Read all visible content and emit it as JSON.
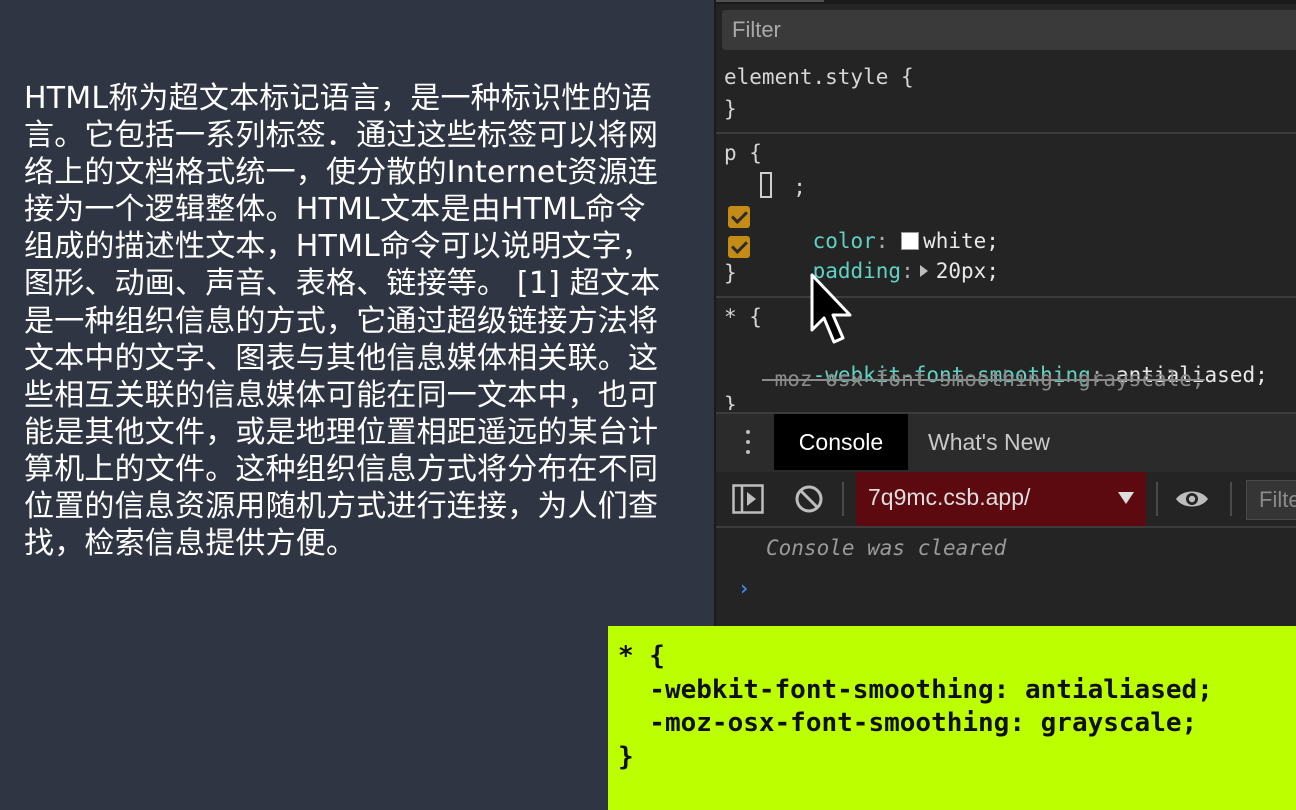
{
  "article": {
    "text": "HTML称为超文本标记语言，是一种标识性的语言。它包括一系列标签．通过这些标签可以将网络上的文档格式统一，使分散的Internet资源连接为一个逻辑整体。HTML文本是由HTML命令组成的描述性文本，HTML命令可以说明文字，图形、动画、声音、表格、链接等。 [1] 超文本是一种组织信息的方式，它通过超级链接方法将文本中的文字、图表与其他信息媒体相关联。这些相互关联的信息媒体可能在同一文本中，也可能是其他文件，或是地理位置相距遥远的某台计算机上的文件。这种组织信息方式将分布在不同位置的信息资源用随机方式进行连接，为人们查找，检索信息提供方便。"
  },
  "styles": {
    "filter_placeholder": "Filter",
    "element_style": {
      "selector": "element.style {",
      "close": "}"
    },
    "p_rule": {
      "selector": "p {",
      "empty_decl": "  ;",
      "color_prop": "color",
      "color_value": "white;",
      "padding_prop": "padding",
      "padding_value": "20px;",
      "close": "}"
    },
    "star_rule": {
      "selector": "* {",
      "decl1_prop": "-webkit-font-smoothing",
      "decl1_value": "antialiased;",
      "decl2": "-moz-osx-font-smoothing: grayscale;",
      "close": "}"
    }
  },
  "drawer": {
    "tabs": [
      {
        "label": "Console"
      },
      {
        "label": "What's New"
      }
    ],
    "context": "7q9mc.csb.app/",
    "filter_placeholder": "Filter",
    "cleared_msg": "Console was cleared",
    "prompt": "›"
  },
  "overlay": {
    "lines": [
      "* {",
      "  -webkit-font-smoothing: antialiased;",
      "  -moz-osx-font-smoothing: grayscale;",
      "}"
    ]
  },
  "colors": {
    "page_bg": "#2f3542",
    "devtools_bg": "#242424",
    "prop": "#5ed3c3",
    "checkbox": "#c48b16",
    "context_bg": "#5c0a10",
    "overlay_bg": "#bbff00",
    "prompt": "#3d8ce8"
  },
  "icons": [
    "checkbox-icon",
    "color-swatch-icon",
    "expand-triangle-icon",
    "kebab-menu-icon",
    "sidebar-toggle-icon",
    "clear-console-icon",
    "dropdown-arrow-icon",
    "eye-icon",
    "console-prompt-icon",
    "mouse-pointer-icon"
  ]
}
